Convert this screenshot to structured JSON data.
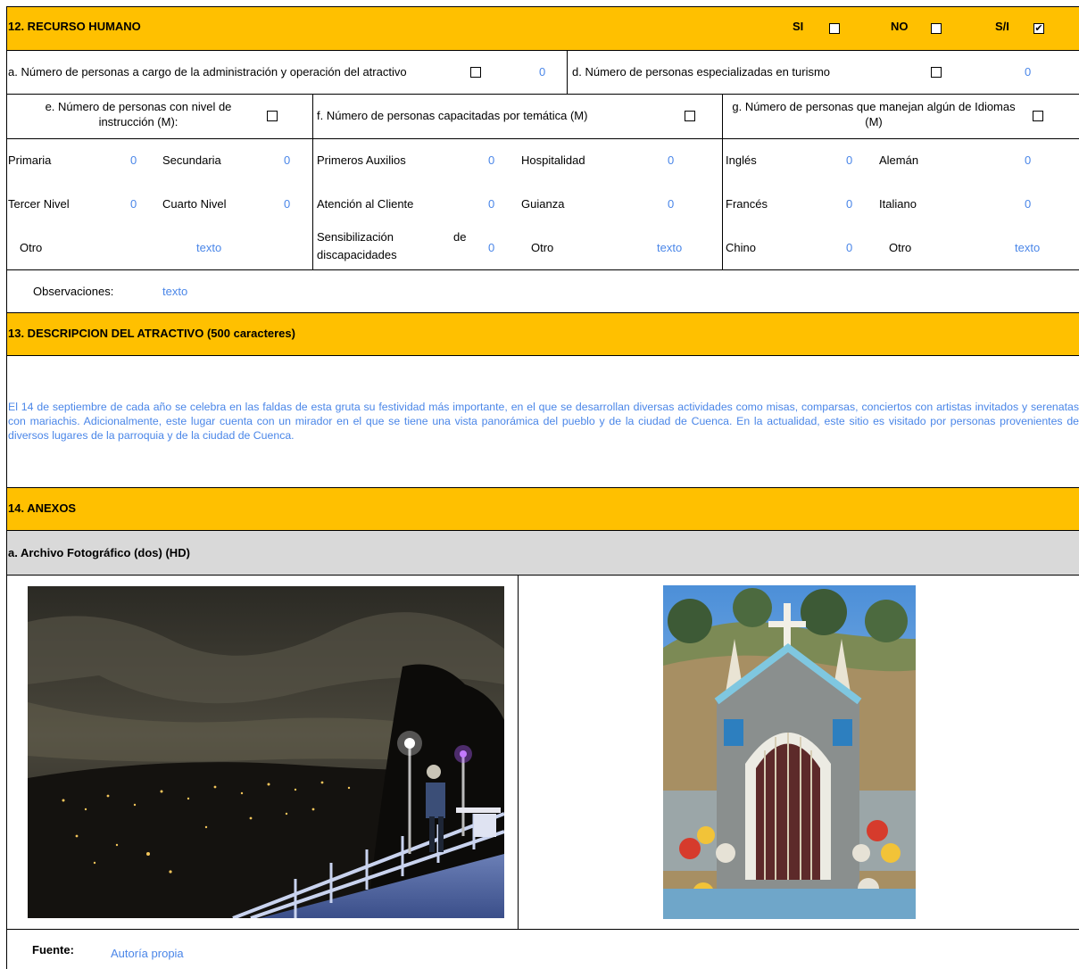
{
  "section12": {
    "title": "12. RECURSO HUMANO",
    "si_label": "SI",
    "no_label": "NO",
    "si_sn_label": "S/I",
    "si_checked": false,
    "no_checked": false,
    "sn_checked": true,
    "check_glyph": "✔"
  },
  "row_a": {
    "label": "a. Número de personas a cargo de la administración y operación del atractivo",
    "value": "0"
  },
  "row_d": {
    "label": "d. Número de personas especializadas en turismo",
    "value": "0"
  },
  "headers": {
    "e": "e. Número de personas con nivel de instrucción (M):",
    "f": "f. Número de personas capacitadas por temática (M)",
    "g": "g. Número de personas que manejan algún de Idiomas (M)"
  },
  "instruccion": {
    "primaria": {
      "label": "Primaria",
      "value": "0"
    },
    "secundaria": {
      "label": "Secundaria",
      "value": "0"
    },
    "tercer": {
      "label": "Tercer Nivel",
      "value": "0"
    },
    "cuarto": {
      "label": "Cuarto Nivel",
      "value": "0"
    },
    "otro": {
      "label": "Otro",
      "value": "texto"
    }
  },
  "tematica": {
    "primeros": {
      "label": "Primeros Auxilios",
      "value": "0"
    },
    "hospitalidad": {
      "label": "Hospitalidad",
      "value": "0"
    },
    "atencion": {
      "label": "Atención al Cliente",
      "value": "0"
    },
    "guianza": {
      "label": "Guianza",
      "value": "0"
    },
    "sensibilizacion": {
      "label_a": "Sensibilización",
      "label_b": "de",
      "label_c": "discapacidades",
      "value": "0"
    },
    "otro": {
      "label": "Otro",
      "value": "texto"
    }
  },
  "idiomas": {
    "ingles": {
      "label": "Inglés",
      "value": "0"
    },
    "aleman": {
      "label": "Alemán",
      "value": "0"
    },
    "frances": {
      "label": "Francés",
      "value": "0"
    },
    "italiano": {
      "label": "Italiano",
      "value": "0"
    },
    "chino": {
      "label": "Chino",
      "value": "0"
    },
    "otro": {
      "label": "Otro",
      "value": "texto"
    }
  },
  "observaciones": {
    "label": "Observaciones:",
    "value": "texto"
  },
  "section13": {
    "title": "13. DESCRIPCION DEL ATRACTIVO (500 caracteres)",
    "text": "El 14 de septiembre de cada año se celebra en las faldas de esta gruta su festividad más importante, en el que se desarrollan diversas actividades como misas, comparsas, conciertos con artistas invitados y serenatas con mariachis. Adicionalmente, este lugar cuenta con un mirador en el que se tiene una vista panorámica del pueblo y de la ciudad de Cuenca. En la actualidad, este sitio es visitado por personas provenientes de diversos lugares de la parroquia y de la ciudad de Cuenca."
  },
  "section14": {
    "title": "14. ANEXOS",
    "subtitle": "a. Archivo Fotográfico (dos) (HD)"
  },
  "fuente": {
    "label": "Fuente:",
    "value": "Autoría propia"
  }
}
